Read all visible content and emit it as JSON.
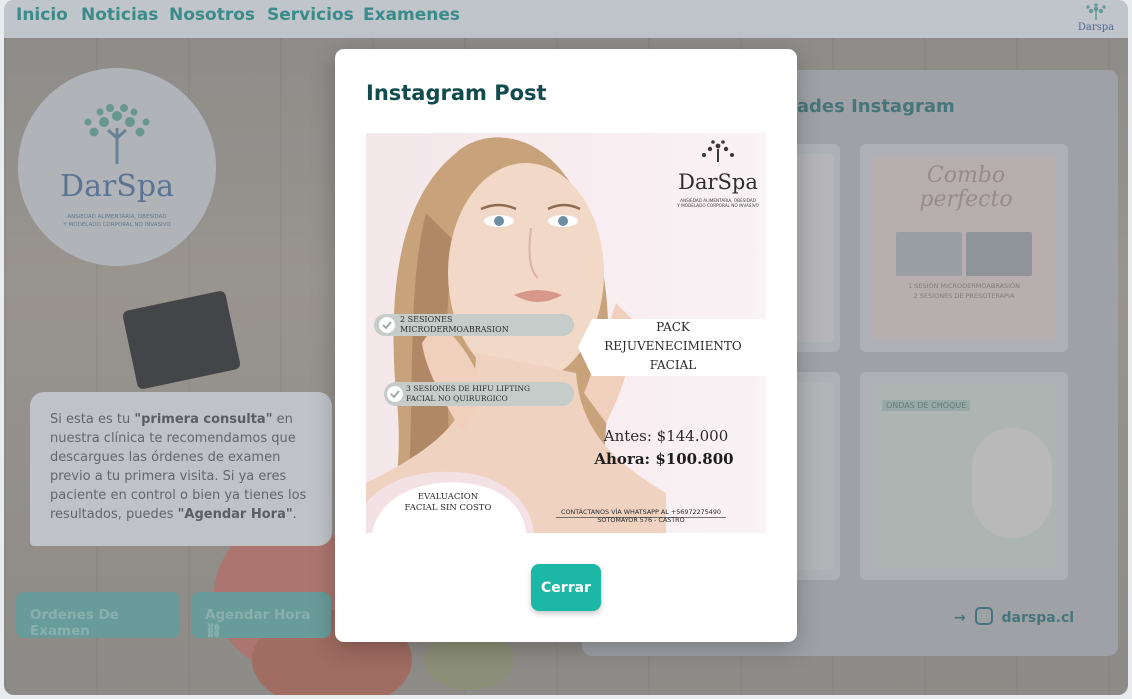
{
  "nav": {
    "items": [
      "Inicio",
      "Noticias",
      "Nosotros",
      "Servicios",
      "Examenes"
    ],
    "logo_text": "Darspa"
  },
  "background": {
    "logo": {
      "brand": "DarSpa",
      "tagline_line1": "ANSIEDAD ALIMENTARIA, OBESIDAD",
      "tagline_line2": "Y MODELADO CORPORAL NO INVASIVO"
    },
    "info": {
      "t1": "Si esta es tu ",
      "b1": "\"primera consulta\"",
      "t2": " en nuestra clínica te recomendamos que descargues las órdenes de examen previo a tu primera visita. Si ya eres paciente en control o bien ya tienes los resultados, puedes ",
      "b2": "\"Agendar Hora\"",
      "t3": "."
    },
    "buttons": {
      "orders": "Ordenes De Examen",
      "schedule": "Agendar Hora"
    },
    "panel_title": "dades Instagram",
    "thumb_text": {
      "combo": "Combo perfecto",
      "ondas": "ONDAS DE CHOQUE",
      "combo_l1": "1 SESIÓN MICRODERMOABRASIÓN",
      "combo_l2": "2 SESIONES DE PRESOTERAPIA"
    },
    "instagram_handle": "darspa.cl"
  },
  "modal": {
    "title": "Instagram Post",
    "close_label": "Cerrar",
    "post": {
      "brand": "DarSpa",
      "brand_tagline_l1": "ANSIEDAD ALIMENTARIA, OBESIDAD",
      "brand_tagline_l2": "Y MODELADO CORPORAL NO INVASIVO",
      "pill1_l1": "2 SESIONES",
      "pill1_l2": "MICRODERMOABRASION",
      "pill2_l1": "3 SESIONES DE HIFU  LIFTING",
      "pill2_l2": "FACIAL NO QUIRURGICO",
      "pack_l1": "PACK",
      "pack_l2": "REJUVENECIMIENTO",
      "pack_l3": "FACIAL",
      "price_before": "Antes: $144.000",
      "price_now": "Ahora: $100.800",
      "eval_l1": "EVALUACION",
      "eval_l2": "FACIAL SIN COSTO",
      "contact_l1": "CONTÁCTANOS VÍA WHATSAPP AL +56972275490",
      "contact_l2": "SOTOMAYOR 576 - CASTRO"
    }
  },
  "colors": {
    "accent": "#1db7a6",
    "title": "#114b4e",
    "nav_link": "#1f8a86"
  }
}
